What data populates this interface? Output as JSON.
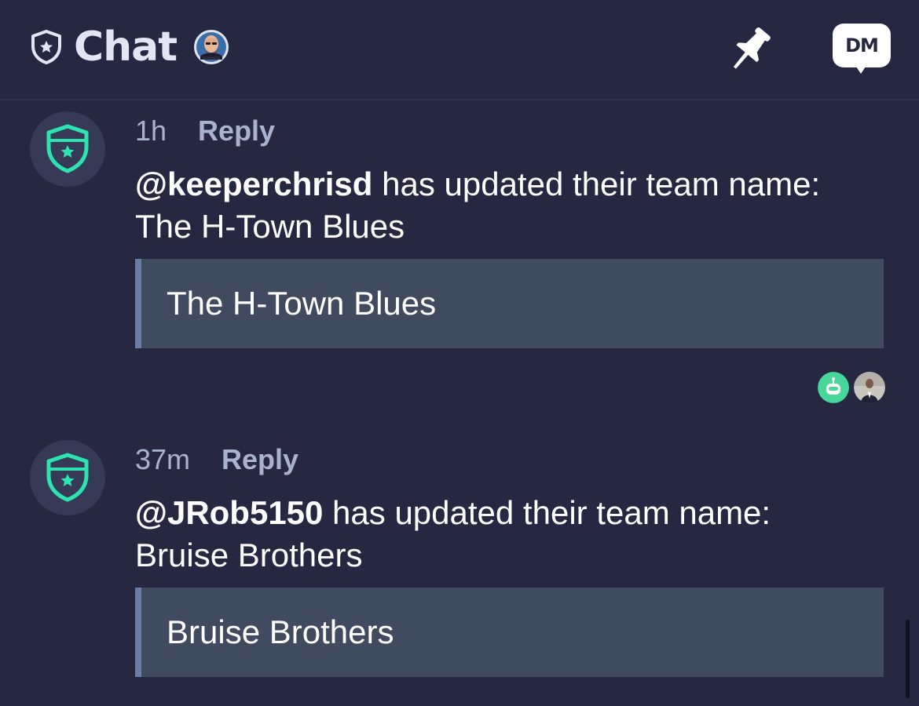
{
  "header": {
    "title": "Chat",
    "shield_icon": "shield-star-icon",
    "pin_icon": "pushpin-icon",
    "dm_label": "DM"
  },
  "colors": {
    "background": "#262842",
    "accent_green": "#2de3b0",
    "quote_bg": "#404b5f",
    "quote_border": "#6b7ca5",
    "meta_text": "#a9b3d0"
  },
  "messages": [
    {
      "time": "1h",
      "reply_label": "Reply",
      "mention": "@keeperchrisd",
      "text_rest": " has updated their team name:",
      "text_line2": "The H-Town Blues",
      "quote": "The H-Town Blues",
      "avatar_icon": "shield-star-icon"
    },
    {
      "time": "37m",
      "reply_label": "Reply",
      "mention": "@JRob5150",
      "text_rest": " has updated their team name:",
      "text_line2": "Bruise Brothers",
      "quote": "Bruise Brothers",
      "avatar_icon": "shield-star-icon"
    }
  ]
}
